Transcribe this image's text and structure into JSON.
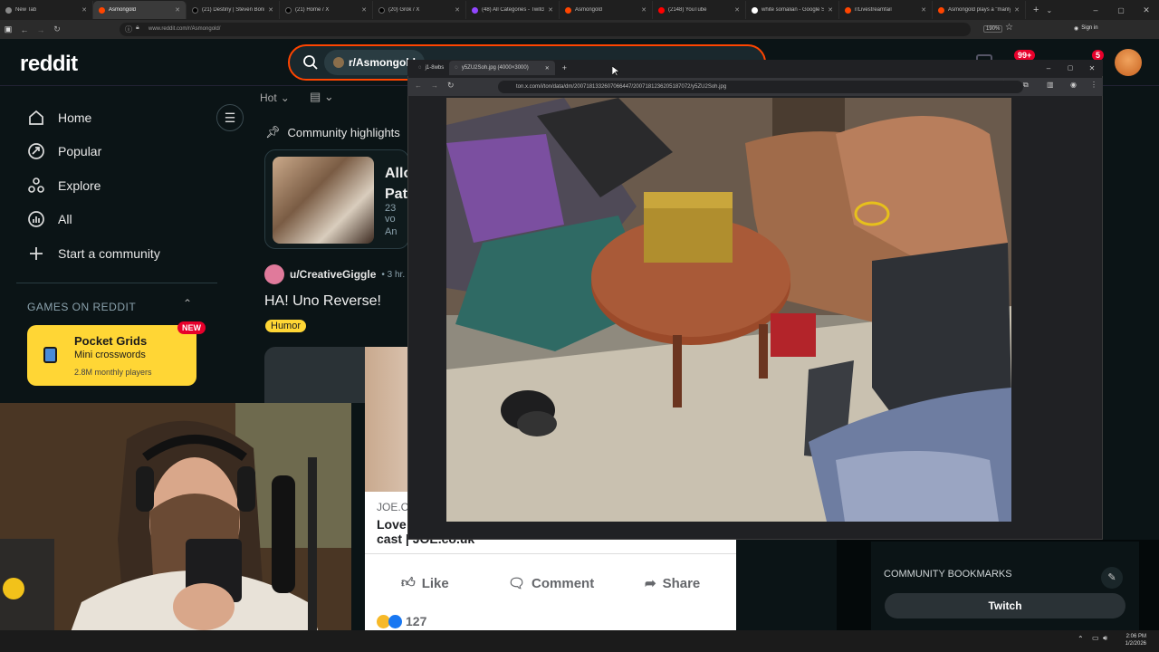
{
  "browser": {
    "tabs": [
      {
        "label": "New Tab"
      },
      {
        "label": "Asmongold"
      },
      {
        "label": "(21) Destiny | Steven Bonnell II"
      },
      {
        "label": "(21) Home / X"
      },
      {
        "label": "(20) Grok / X"
      },
      {
        "label": "(48) All Categories - Twitch"
      },
      {
        "label": "Asmongold"
      },
      {
        "label": "(2148) YouTube"
      },
      {
        "label": "white somalian - Google Search"
      },
      {
        "label": "r/Livestreamfail"
      },
      {
        "label": "Asmongold plays a \"manly\" ..."
      }
    ],
    "url": "www.reddit.com/r/Asmongold/",
    "zoom": "190%",
    "sign_in": "Sign in"
  },
  "reddit": {
    "logo": "reddit",
    "search_chip": "r/Asmongold",
    "badge_count": "99+",
    "notif_count": "5",
    "nav": {
      "home": "Home",
      "popular": "Popular",
      "explore": "Explore",
      "all": "All",
      "start_community": "Start a community"
    },
    "games_header": "GAMES ON REDDIT",
    "pocket": {
      "title": "Pocket Grids",
      "subtitle": "Mini crosswords",
      "players": "2.8M monthly players",
      "badge": "NEW"
    },
    "sort": "Hot",
    "highlights": "Community highlights",
    "highlight_title_a": "Allo",
    "highlight_title_b": "Pat",
    "highlight_votes": "23 vo",
    "highlight_meta": "An",
    "post": {
      "user": "u/CreativeGiggle",
      "time": "• 3 hr.",
      "title": "HA! Uno Reverse!",
      "flair": "Humor"
    },
    "bookmarks_header": "COMMUNITY BOOKMARKS",
    "twitch_button": "Twitch"
  },
  "popup": {
    "tabs": [
      {
        "label": "j1-8wbs"
      },
      {
        "label": "y5ZU2Soh.jpg (4000×3000)"
      }
    ],
    "url": "ton.x.com/i/ton/data/dm/2007181332607066447/2007181236205187072/y5ZU2Soh.jpg"
  },
  "fbcard": {
    "source": "JOE.C",
    "headline_line1": "Love Island",
    "headline_line2": "cast | JOE.co.uk",
    "like": "Like",
    "comment": "Comment",
    "share": "Share",
    "reactions": "127"
  },
  "taskbar": {
    "time": "2:06 PM",
    "date": "1/2/2026"
  },
  "colors": {
    "reddit_orange": "#ff4500",
    "pocket_yellow": "#ffd635",
    "new_badge": "#e8002b",
    "flair": "#ffd635"
  }
}
